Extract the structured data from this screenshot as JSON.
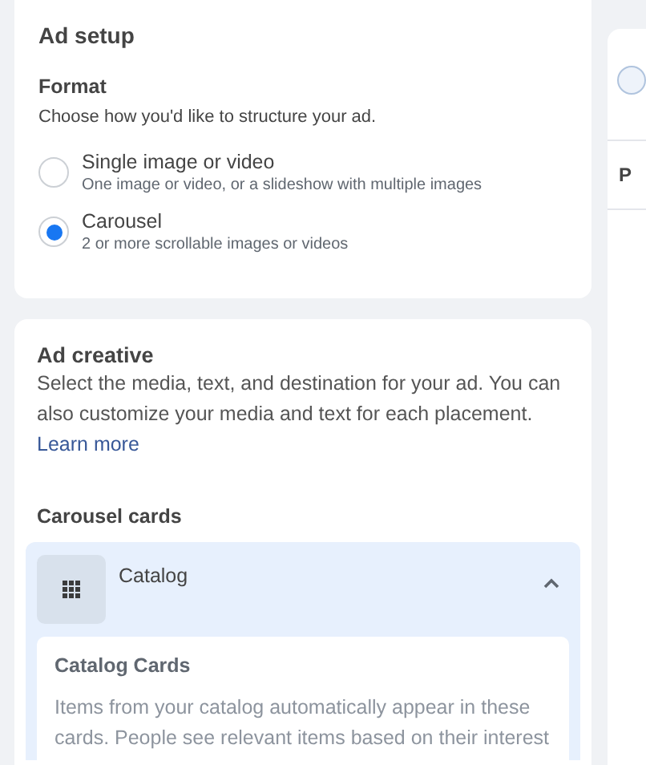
{
  "ad_setup": {
    "title": "Ad setup",
    "format": {
      "label": "Format",
      "description": "Choose how you'd like to structure your ad.",
      "options": [
        {
          "label": "Single image or video",
          "description": "One image or video, or a slideshow with multiple images",
          "selected": false
        },
        {
          "label": "Carousel",
          "description": "2 or more scrollable images or videos",
          "selected": true
        }
      ]
    }
  },
  "ad_creative": {
    "title": "Ad creative",
    "description": "Select the media, text, and destination for your ad. You can also customize your media and text for each placement.",
    "link": "Learn more",
    "carousel_cards": {
      "label": "Carousel cards",
      "source": {
        "label": "Catalog",
        "expanded": true,
        "panel_title": "Catalog Cards",
        "panel_text": "Items from your catalog automatically appear in these cards. People see relevant items based on their interest"
      }
    }
  },
  "side_panel": {
    "label": "P"
  }
}
